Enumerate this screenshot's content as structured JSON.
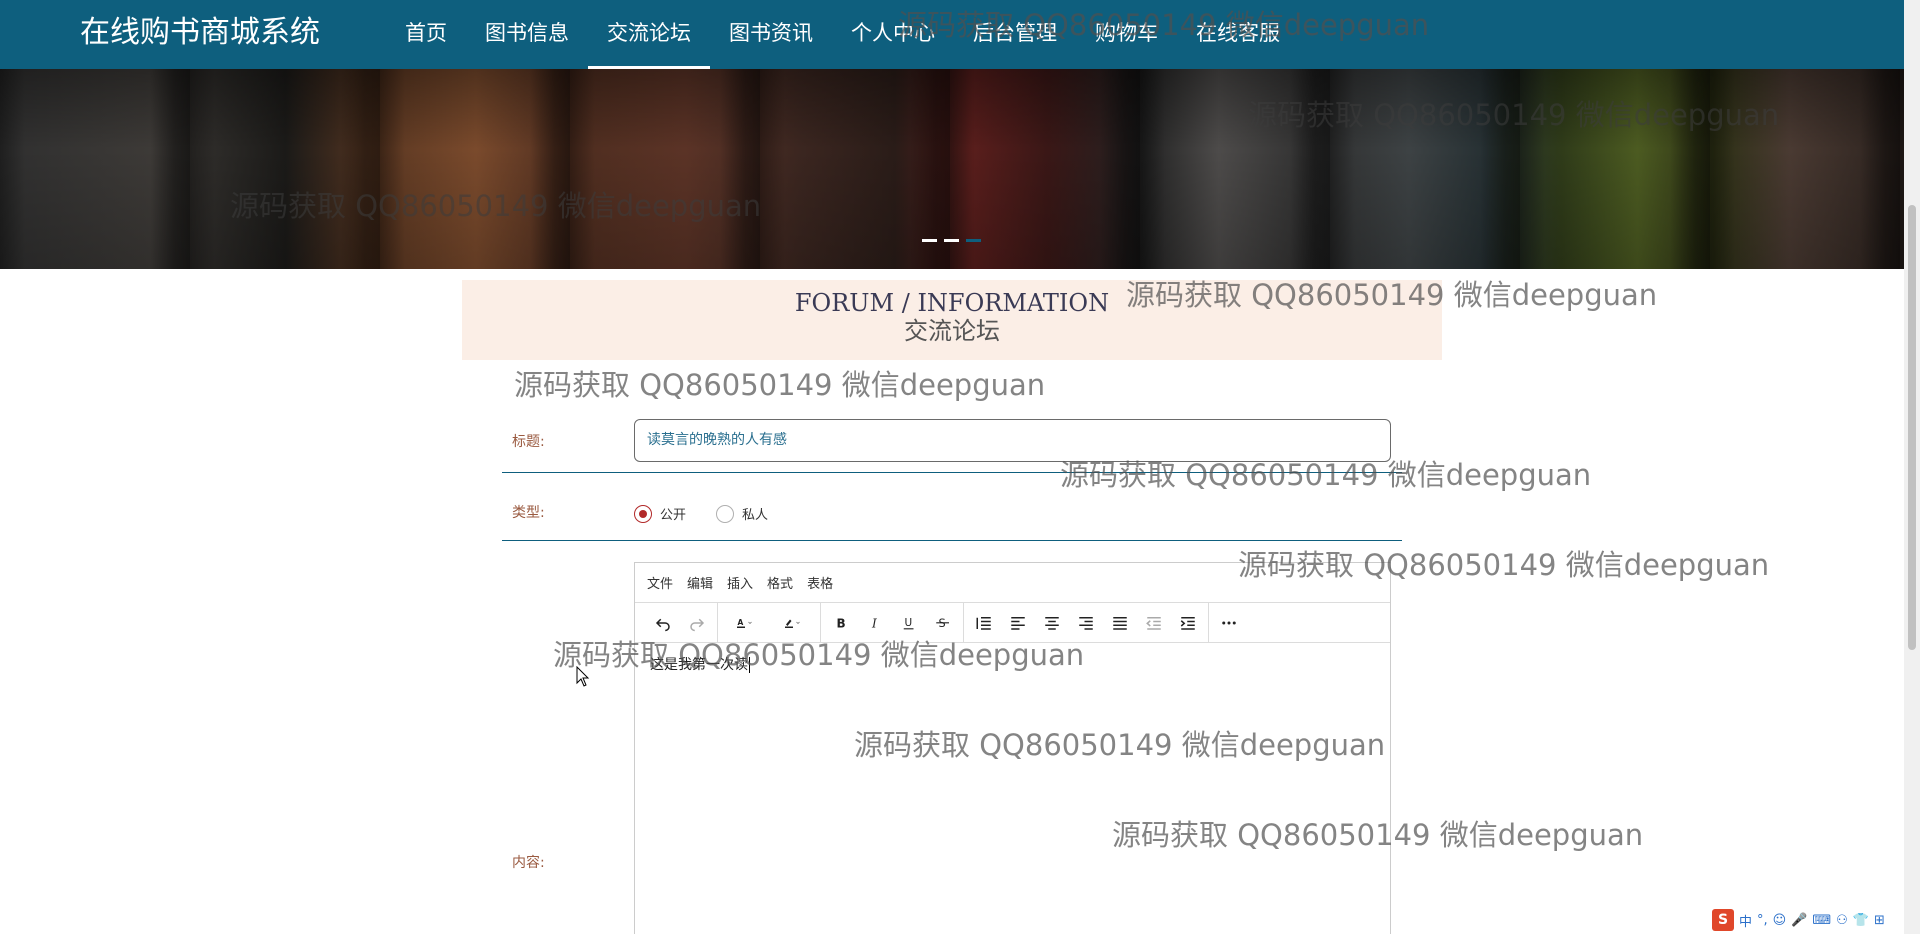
{
  "header": {
    "brand": "在线购书商城系统",
    "nav": [
      {
        "label": "首页"
      },
      {
        "label": "图书信息"
      },
      {
        "label": "交流论坛"
      },
      {
        "label": "图书资讯"
      },
      {
        "label": "个人中心"
      },
      {
        "label": "后台管理"
      },
      {
        "label": "购物车"
      },
      {
        "label": "在线客服"
      }
    ],
    "active_nav": "交流论坛"
  },
  "banner": {
    "slides": 3,
    "active_slide": 3
  },
  "section": {
    "title_en": "FORUM / INFORMATION",
    "title_cn": "交流论坛"
  },
  "form": {
    "title_label": "标题:",
    "title_value": "读莫言的晚熟的人有感",
    "type_label": "类型:",
    "type_options": [
      "公开",
      "私人"
    ],
    "type_selected": "公开",
    "content_label": "内容:"
  },
  "editor": {
    "menus": [
      "文件",
      "编辑",
      "插入",
      "格式",
      "表格"
    ],
    "toolbar_icons": [
      "undo-icon",
      "redo-icon",
      "text-color-icon",
      "highlight-icon",
      "bold-icon",
      "italic-icon",
      "underline-icon",
      "strikethrough-icon",
      "line-height-icon",
      "align-left-icon",
      "align-center-icon",
      "align-right-icon",
      "align-justify-icon",
      "outdent-icon",
      "indent-icon",
      "more-icon"
    ],
    "content": "这是我第一次读"
  },
  "watermark": "源码获取 QQ86050149 微信deepguan",
  "tray": {
    "ime": "中",
    "punct": "°,"
  },
  "colors": {
    "header_bg": "#0e5f7e",
    "title_band": "#fbeee6",
    "label": "#9a5a40",
    "radio_checked": "#b22a2a"
  }
}
